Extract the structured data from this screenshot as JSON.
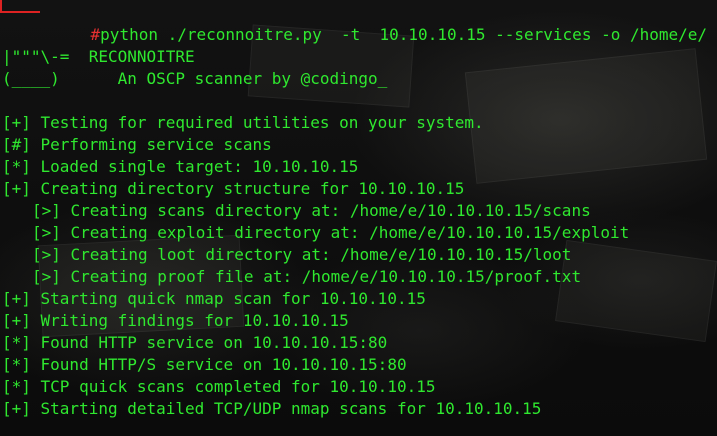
{
  "prompt": {
    "symbol": "#",
    "command": "python ./reconnoitre.py  -t  10.10.10.15 --services -o /home/e/"
  },
  "banner": {
    "line1_art": "|\"\"\"\\-=  RECONNOITRE",
    "line2_art": "(____)      An OSCP scanner by @codingo_"
  },
  "output": [
    "[+] Testing for required utilities on your system.",
    "[#] Performing service scans",
    "[*] Loaded single target: 10.10.10.15",
    "[+] Creating directory structure for 10.10.10.15",
    "[>] Creating scans directory at: /home/e/10.10.10.15/scans",
    "[>] Creating exploit directory at: /home/e/10.10.10.15/exploit",
    "[>] Creating loot directory at: /home/e/10.10.10.15/loot",
    "[>] Creating proof file at: /home/e/10.10.10.15/proof.txt",
    "[+] Starting quick nmap scan for 10.10.10.15",
    "[+] Writing findings for 10.10.10.15",
    "[*] Found HTTP service on 10.10.10.15:80",
    "[*] Found HTTP/S service on 10.10.10.15:80",
    "[*] TCP quick scans completed for 10.10.10.15",
    "[+] Starting detailed TCP/UDP nmap scans for 10.10.10.15"
  ],
  "colors": {
    "text": "#2fe82f",
    "prompt_accent": "#e63030",
    "background": "#0e0e0e"
  }
}
